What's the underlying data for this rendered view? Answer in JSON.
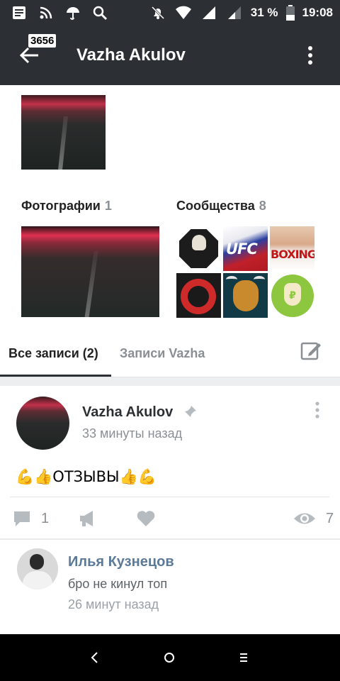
{
  "status_bar": {
    "battery": "31 %",
    "time": "19:08"
  },
  "toolbar": {
    "badge": "3656",
    "title": "Vazha Akulov"
  },
  "sections": {
    "photos_label": "Фотографии",
    "photos_count": "1",
    "communities_label": "Сообщества",
    "communities_count": "8",
    "communities": [
      {
        "name": "skull-club",
        "text": ""
      },
      {
        "name": "ufc",
        "text": "UFC"
      },
      {
        "name": "boxing-club",
        "text": "BOXING"
      },
      {
        "name": "red-emblem",
        "text": ""
      },
      {
        "name": "bull",
        "text": ""
      },
      {
        "name": "money-bag",
        "text": "₽"
      }
    ]
  },
  "tabs": {
    "all_posts": "Все записи (2)",
    "own_posts": "Записи Vazha"
  },
  "post": {
    "author": "Vazha Akulov",
    "time": "33 минуты назад",
    "text": "💪👍ОТЗЫВЫ👍💪",
    "comments_count": "1",
    "views_count": "7"
  },
  "comment": {
    "author": "Илья Кузнецов",
    "text": "бро не кинул топ",
    "time": "26 минут назад"
  },
  "colors": {
    "toolbar_bg": "#2c3034",
    "link_blue": "#5b7a9a",
    "muted_gray": "#8a8f94"
  }
}
